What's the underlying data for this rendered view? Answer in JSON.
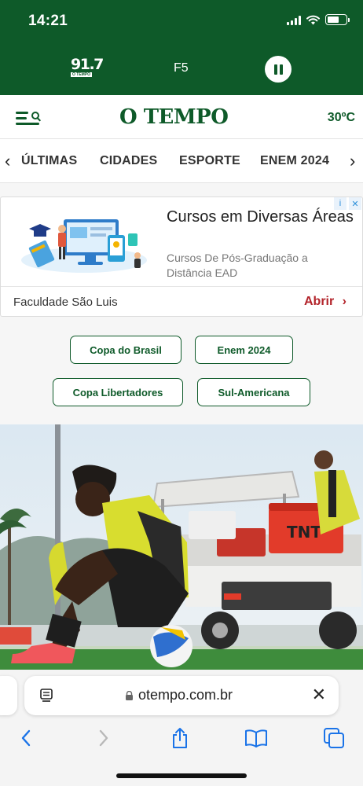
{
  "status_bar": {
    "time": "14:21",
    "battery_level": 0.65
  },
  "radio": {
    "logo_text": "91.7",
    "logo_sub": "O TEMPO",
    "station": "F5"
  },
  "header": {
    "logo": "O TEMPO",
    "temperature": "30ºC"
  },
  "categories": {
    "items": [
      "ÚLTIMAS",
      "CIDADES",
      "ESPORTE",
      "ENEM 2024"
    ],
    "prev_arrow": "‹",
    "next_arrow": "›"
  },
  "ad": {
    "title": "Cursos em Diversas Áreas",
    "description": "Cursos De Pós-Graduação a Distância EAD",
    "sponsor": "Faculdade São Luis",
    "cta": "Abrir",
    "cta_arrow": "›",
    "badge_info": "i",
    "badge_close": "✕"
  },
  "tags": [
    "Copa do Brasil",
    "Enem 2024",
    "Copa Libertadores",
    "Sul-Americana"
  ],
  "hero": {
    "cart_brand": "TNT"
  },
  "browser": {
    "url": "otempo.com.br",
    "close": "✕"
  },
  "colors": {
    "brand_green": "#0e5a29",
    "ios_blue": "#1a73e8",
    "ad_cta": "#b3242b"
  }
}
